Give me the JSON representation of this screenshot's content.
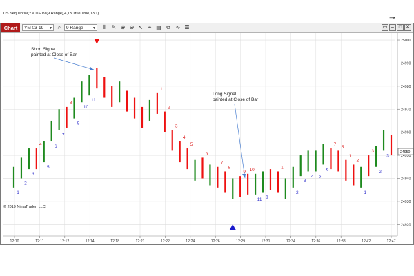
{
  "toolbar": {
    "chart_tab": "Chart",
    "instrument": "YM 03-19",
    "interval": "9 Range",
    "window_buttons": [
      "▭",
      "–",
      "□",
      "✕"
    ]
  },
  "plot": {
    "indicator_label": "TIS Sequential(YM 03-19 (9 Range),4,13,True,True,13,1)",
    "copyright": "© 2019 NinjaTrader, LLC",
    "price_box": "24950"
  },
  "annotations": {
    "short_line1": "Short Signal",
    "short_line2": "painted at Close of Bar",
    "long_line1": "Long Signal",
    "long_line2": "painted at Close of Bar"
  },
  "colors": {
    "up": "#1e8a1e",
    "down": "#ee1111",
    "count_up": "#3333cc",
    "count_down": "#dd2222",
    "signal_down": "#ee1111",
    "signal_up": "#1a1acc",
    "grid": "#dcdcdc"
  },
  "icons": [
    "search-icon",
    "pencil-icon",
    "zoom-in-icon",
    "zoom-out-icon",
    "cursor-icon",
    "crosshair-icon",
    "template-icon",
    "draw-icon",
    "properties-icon"
  ],
  "chart_data": {
    "type": "bar",
    "subtype": "ohlc-range-bars",
    "y_axis_ticks": [
      25000,
      24990,
      24980,
      24970,
      24960,
      24950,
      24940,
      24930,
      24920
    ],
    "ylim": [
      24915,
      25003
    ],
    "x_axis_ticks": [
      "12:10",
      "12:11",
      "12:12",
      "12:14",
      "12:18",
      "12:21",
      "12:22",
      "12:24",
      "12:26",
      "12:29",
      "12:31",
      "12:34",
      "12:36",
      "12:38",
      "12:42",
      "12:47"
    ],
    "bars": [
      {
        "dir": "up",
        "low": 24936,
        "high": 24945,
        "label": "1"
      },
      {
        "dir": "up",
        "low": 24940,
        "high": 24949,
        "label": "2"
      },
      {
        "dir": "up",
        "low": 24944,
        "high": 24953,
        "label": "3"
      },
      {
        "dir": "down",
        "low": 24944,
        "high": 24953,
        "label": "4"
      },
      {
        "dir": "up",
        "low": 24947,
        "high": 24956,
        "label": "5"
      },
      {
        "dir": "up",
        "low": 24956,
        "high": 24965,
        "label": "6"
      },
      {
        "dir": "up",
        "low": 24961,
        "high": 24970,
        "label": "7"
      },
      {
        "dir": "down",
        "low": 24962,
        "high": 24971,
        "label": "8"
      },
      {
        "dir": "up",
        "low": 24966,
        "high": 24975,
        "label": "9"
      },
      {
        "dir": "up",
        "low": 24973,
        "high": 24982,
        "label": "10"
      },
      {
        "dir": "up",
        "low": 24976,
        "high": 24985,
        "label": "11"
      },
      {
        "dir": "down",
        "low": 24979,
        "high": 24988,
        "label": "",
        "signal": "short"
      },
      {
        "dir": "down",
        "low": 24975,
        "high": 24984,
        "label": ""
      },
      {
        "dir": "down",
        "low": 24971,
        "high": 24980,
        "label": ""
      },
      {
        "dir": "up",
        "low": 24973,
        "high": 24982,
        "label": ""
      },
      {
        "dir": "down",
        "low": 24969,
        "high": 24978,
        "label": ""
      },
      {
        "dir": "down",
        "low": 24966,
        "high": 24975,
        "label": ""
      },
      {
        "dir": "down",
        "low": 24962,
        "high": 24971,
        "label": ""
      },
      {
        "dir": "up",
        "low": 24965,
        "high": 24974,
        "label": ""
      },
      {
        "dir": "down",
        "low": 24968,
        "high": 24977,
        "label": "1"
      },
      {
        "dir": "down",
        "low": 24960,
        "high": 24969,
        "label": "2"
      },
      {
        "dir": "down",
        "low": 24952,
        "high": 24961,
        "label": "3"
      },
      {
        "dir": "down",
        "low": 24947,
        "high": 24956,
        "label": "4"
      },
      {
        "dir": "down",
        "low": 24944,
        "high": 24953,
        "label": "5"
      },
      {
        "dir": "up",
        "low": 24939,
        "high": 24948,
        "label": ""
      },
      {
        "dir": "down",
        "low": 24940,
        "high": 24949,
        "label": "6"
      },
      {
        "dir": "up",
        "low": 24937,
        "high": 24946,
        "label": ""
      },
      {
        "dir": "down",
        "low": 24936,
        "high": 24945,
        "label": "7"
      },
      {
        "dir": "down",
        "low": 24934,
        "high": 24943,
        "label": "8"
      },
      {
        "dir": "up",
        "low": 24931,
        "high": 24940,
        "label": "",
        "signal": "long"
      },
      {
        "dir": "down",
        "low": 24932,
        "high": 24941,
        "label": "9"
      },
      {
        "dir": "down",
        "low": 24933,
        "high": 24942,
        "label": "10"
      },
      {
        "dir": "up",
        "low": 24933,
        "high": 24942,
        "label": "11"
      },
      {
        "dir": "up",
        "low": 24934,
        "high": 24943,
        "label": "1"
      },
      {
        "dir": "down",
        "low": 24935,
        "high": 24944,
        "label": ""
      },
      {
        "dir": "down",
        "low": 24934,
        "high": 24943,
        "label": "1"
      },
      {
        "dir": "up",
        "low": 24931,
        "high": 24940,
        "label": ""
      },
      {
        "dir": "up",
        "low": 24936,
        "high": 24945,
        "label": "2"
      },
      {
        "dir": "up",
        "low": 24941,
        "high": 24950,
        "label": "3"
      },
      {
        "dir": "up",
        "low": 24943,
        "high": 24952,
        "label": "4"
      },
      {
        "dir": "up",
        "low": 24943,
        "high": 24952,
        "label": "5"
      },
      {
        "dir": "up",
        "low": 24946,
        "high": 24955,
        "label": "6"
      },
      {
        "dir": "down",
        "low": 24944,
        "high": 24953,
        "label": "7"
      },
      {
        "dir": "down",
        "low": 24943,
        "high": 24952,
        "label": "8"
      },
      {
        "dir": "down",
        "low": 24939,
        "high": 24948,
        "label": "1"
      },
      {
        "dir": "down",
        "low": 24937,
        "high": 24946,
        "label": "2"
      },
      {
        "dir": "up",
        "low": 24936,
        "high": 24945,
        "label": "1"
      },
      {
        "dir": "down",
        "low": 24941,
        "high": 24950,
        "label": "3"
      },
      {
        "dir": "up",
        "low": 24945,
        "high": 24954,
        "label": "2"
      },
      {
        "dir": "up",
        "low": 24952,
        "high": 24961,
        "label": "3"
      },
      {
        "dir": "down",
        "low": 24950,
        "high": 24959,
        "label": ""
      }
    ],
    "legend": "none",
    "grid": true
  }
}
